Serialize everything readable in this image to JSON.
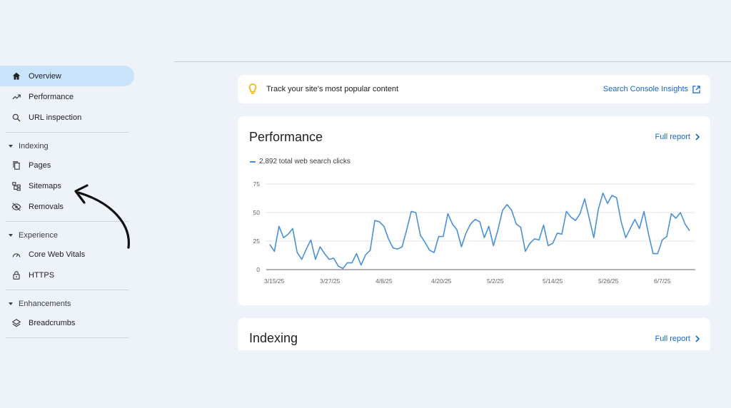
{
  "sidebar": {
    "items": [
      {
        "label": "Overview",
        "icon": "home-icon"
      },
      {
        "label": "Performance",
        "icon": "trending-icon"
      },
      {
        "label": "URL inspection",
        "icon": "search-icon"
      }
    ],
    "sections": [
      {
        "title": "Indexing",
        "items": [
          {
            "label": "Pages",
            "icon": "pages-icon"
          },
          {
            "label": "Sitemaps",
            "icon": "sitemap-icon"
          },
          {
            "label": "Removals",
            "icon": "eye-off-icon"
          }
        ]
      },
      {
        "title": "Experience",
        "items": [
          {
            "label": "Core Web Vitals",
            "icon": "gauge-icon"
          },
          {
            "label": "HTTPS",
            "icon": "lock-icon"
          }
        ]
      },
      {
        "title": "Enhancements",
        "items": [
          {
            "label": "Breadcrumbs",
            "icon": "layers-icon"
          }
        ]
      }
    ]
  },
  "insights": {
    "message": "Track your site's most popular content",
    "link": "Search Console Insights"
  },
  "performance": {
    "title": "Performance",
    "full_report": "Full report",
    "legend": "2,892 total web search clicks"
  },
  "indexing": {
    "title": "Indexing",
    "full_report": "Full report"
  },
  "colors": {
    "accent": "#1a66c9",
    "series": "#4a90d9",
    "active_bg": "#c9e3fb"
  },
  "chart_data": {
    "type": "line",
    "title": "",
    "xlabel": "",
    "ylabel": "",
    "ylim": [
      0,
      75
    ],
    "yticks": [
      "0",
      "25",
      "50",
      "75"
    ],
    "xticks": [
      "3/15/25",
      "3/27/25",
      "4/8/25",
      "4/20/25",
      "5/2/25",
      "5/14/25",
      "5/26/25",
      "6/7/25"
    ],
    "grid": true,
    "series": [
      {
        "name": "2,892 total web search clicks",
        "values": [
          22,
          16,
          38,
          28,
          31,
          36,
          15,
          9,
          18,
          26,
          9,
          20,
          14,
          9,
          10,
          3,
          1,
          6,
          6,
          14,
          4,
          13,
          17,
          43,
          42,
          38,
          27,
          19,
          18,
          20,
          35,
          51,
          50,
          30,
          24,
          17,
          15,
          29,
          29,
          49,
          40,
          35,
          20,
          32,
          40,
          44,
          42,
          28,
          38,
          21,
          35,
          52,
          57,
          52,
          40,
          37,
          16,
          23,
          27,
          26,
          39,
          21,
          23,
          32,
          31,
          51,
          46,
          43,
          49,
          62,
          45,
          28,
          53,
          67,
          58,
          65,
          63,
          42,
          28,
          36,
          44,
          36,
          51,
          31,
          14,
          14,
          26,
          29,
          49,
          45,
          50,
          40,
          34
        ]
      }
    ]
  }
}
